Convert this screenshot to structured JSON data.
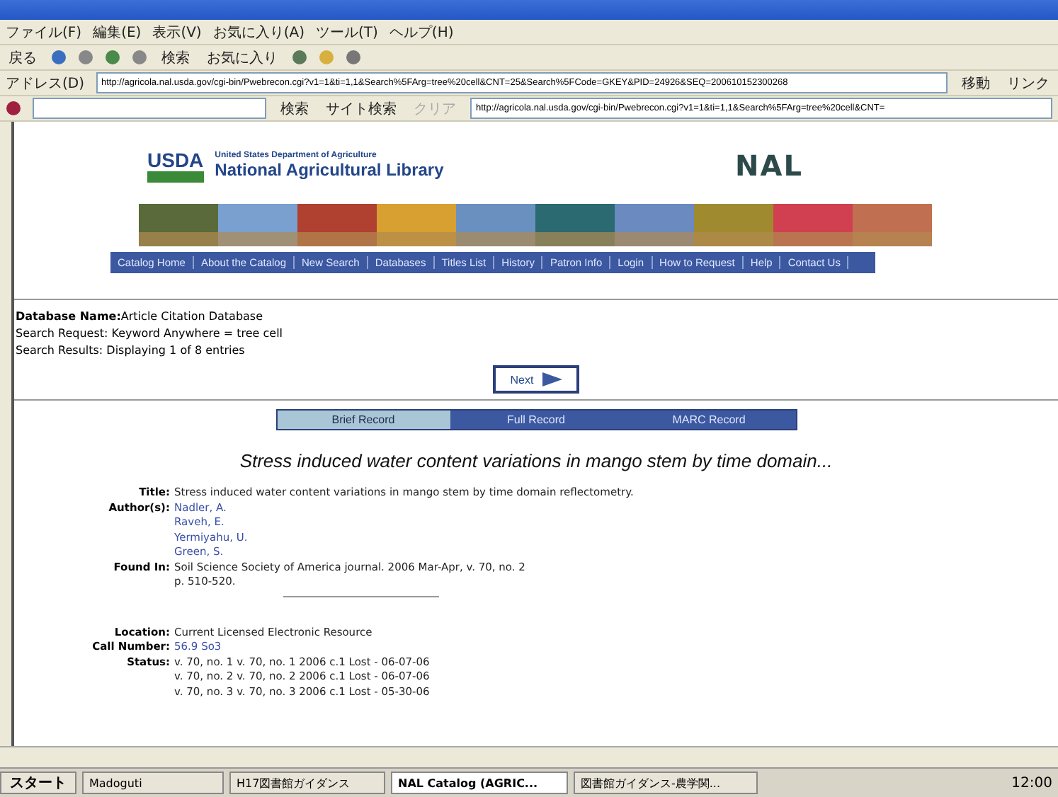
{
  "menu_bar": [
    "ファイル(F)",
    "編集(E)",
    "表示(V)",
    "お気に入り(A)",
    "ツール(T)",
    "ヘルプ(H)"
  ],
  "toolbar": {
    "back": "戻る",
    "search": "検索",
    "favorites": "お気に入り"
  },
  "address_bar": {
    "label": "アドレス(D)",
    "url": "http://agricola.nal.usda.gov/cgi-bin/Pwebrecon.cgi?v1=1&ti=1,1&Search%5FArg=tree%20cell&CNT=25&Search%5FCode=GKEY&PID=24926&SEQ=200610152300268",
    "go": "移動",
    "links": "リンク"
  },
  "search_toolbar": {
    "search": "検索",
    "site_search": "サイト検索",
    "clear": "クリア",
    "url": "http://agricola.nal.usda.gov/cgi-bin/Pwebrecon.cgi?v1=1&ti=1,1&Search%5FArg=tree%20cell&CNT="
  },
  "header": {
    "usda": "USDA",
    "department": "United States Department of Agriculture",
    "library": "National Agricultural Library",
    "nal_logo": "NAL"
  },
  "nav": [
    "Catalog Home",
    "About the Catalog",
    "New Search",
    "Databases",
    "Titles List",
    "History",
    "Patron Info",
    "Login",
    "How to Request",
    "Help",
    "Contact Us"
  ],
  "search_info": {
    "database_label": "Database Name:",
    "database": "Article Citation Database",
    "request": "Search Request: Keyword Anywhere = tree cell",
    "results": "Search Results: Displaying 1 of 8 entries"
  },
  "next_button": "Next",
  "record_tabs": [
    {
      "label": "Brief Record",
      "selected": true
    },
    {
      "label": "Full Record",
      "selected": false
    },
    {
      "label": "MARC Record",
      "selected": false
    }
  ],
  "record_heading": "Stress induced water content variations in mango stem by time domain...",
  "record_fields": [
    {
      "label": "Title:",
      "values": [
        {
          "text": "Stress induced water content variations in mango stem by time domain reflectometry.",
          "kind": "text"
        }
      ]
    },
    {
      "label": "Author(s):",
      "values": [
        {
          "text": "Nadler, A.",
          "kind": "link"
        },
        {
          "text": "Raveh, E.",
          "kind": "link"
        },
        {
          "text": "Yermiyahu, U.",
          "kind": "link"
        },
        {
          "text": "Green, S.",
          "kind": "link"
        }
      ]
    },
    {
      "label": "Found In:",
      "values": [
        {
          "text": "Soil Science Society of America journal. 2006 Mar-Apr, v. 70, no. 2",
          "kind": "text"
        },
        {
          "text": "p. 510-520.",
          "kind": "text"
        }
      ]
    }
  ],
  "holdings_fields": [
    {
      "label": "Location:",
      "values": [
        {
          "text": "Current Licensed Electronic Resource",
          "kind": "text"
        }
      ]
    },
    {
      "label": "Call Number:",
      "values": [
        {
          "text": "56.9 So3",
          "kind": "link"
        }
      ]
    },
    {
      "label": "Status:",
      "values": [
        {
          "text": "v. 70, no. 1 v. 70, no. 1 2006 c.1 Lost - 06-07-06",
          "kind": "text"
        },
        {
          "text": "v. 70, no. 2 v. 70, no. 2 2006 c.1 Lost - 06-07-06",
          "kind": "text"
        },
        {
          "text": "v. 70, no. 3 v. 70, no. 3 2006 c.1 Lost - 05-30-06",
          "kind": "text"
        }
      ]
    }
  ],
  "taskbar": {
    "start": "スタート",
    "tasks": [
      {
        "label": "Madoguti",
        "selected": false
      },
      {
        "label": "H17図書館ガイダンス",
        "selected": false
      },
      {
        "label": "NAL Catalog (AGRIC...",
        "selected": true
      },
      {
        "label": "図書館ガイダンス-農学関...",
        "selected": false
      }
    ],
    "clock": "12:00"
  }
}
